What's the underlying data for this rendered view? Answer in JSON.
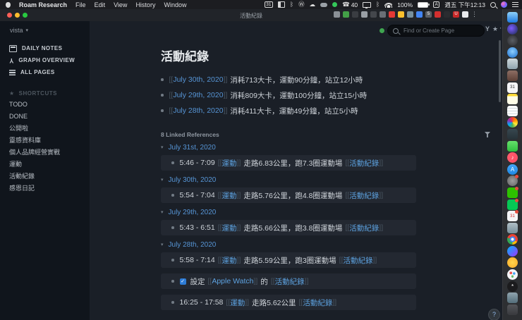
{
  "syntax": {
    "open": "[[",
    "close": "]]"
  },
  "menu_bar": {
    "app_name": "Roam Research",
    "menus": [
      "File",
      "Edit",
      "View",
      "History",
      "Window"
    ],
    "status_icons": [
      {
        "n": "calendar-date-icon",
        "t": "box",
        "v": "31"
      },
      {
        "n": "window-layout-icon",
        "t": "tiles"
      },
      {
        "n": "bluetooth-icon",
        "t": "glyph",
        "v": "ᛒ"
      },
      {
        "n": "wordpress-icon",
        "t": "glyph",
        "v": "Ⓦ"
      },
      {
        "n": "cloud-icon",
        "t": "glyph",
        "v": "☁"
      },
      {
        "n": "widget-pill-icon",
        "t": "pill"
      },
      {
        "n": "green-status-icon",
        "t": "dot"
      },
      {
        "n": "phone-calls-icon",
        "t": "phone",
        "v": "40"
      },
      {
        "n": "screen-mirroring-icon",
        "t": "display"
      },
      {
        "n": "bluetooth-icon-2",
        "t": "glyph",
        "v": "ᛒ"
      },
      {
        "n": "wifi-icon",
        "t": "wifi"
      },
      {
        "n": "battery-percentage",
        "t": "text",
        "v": "100%"
      },
      {
        "n": "battery-icon",
        "t": "battery"
      },
      {
        "n": "input-source-icon",
        "t": "box",
        "v": "A"
      },
      {
        "n": "menubar-clock",
        "t": "text",
        "v": "週五 下午12:13"
      },
      {
        "n": "spotlight-icon",
        "t": "search"
      },
      {
        "n": "siri-icon",
        "t": "siri"
      },
      {
        "n": "control-center-icon",
        "t": "lines"
      }
    ]
  },
  "window": {
    "title": "活動紀錄"
  },
  "extensions": [
    {
      "n": "shield-extension-icon",
      "bg": "#8a9096"
    },
    {
      "n": "leaf-extension-icon",
      "bg": "#43a047"
    },
    {
      "n": "dark-extension-icon",
      "bg": "#3a3d42"
    },
    {
      "n": "video-extension-icon",
      "bg": "#9aa0a6"
    },
    {
      "n": "pencil-extension-icon",
      "bg": "#44474c"
    },
    {
      "n": "gray-box-extension-icon",
      "bg": "#6a6f75"
    },
    {
      "n": "youtube-extension-icon",
      "bg": "#e53935"
    },
    {
      "n": "yellow-extension-icon",
      "bg": "#fbc02d"
    },
    {
      "n": "globe-extension-icon",
      "bg": "#78909c"
    },
    {
      "n": "blue-shield-extension-icon",
      "bg": "#4285f4"
    },
    {
      "n": "counter-extension-icon",
      "bg": "#5c6065",
      "g": "5"
    },
    {
      "n": "red-lines-extension-icon",
      "bg": "#d32f2f"
    },
    {
      "n": "dark-circle-extension-icon",
      "bg": "#2a2c30"
    },
    {
      "n": "u-extension-icon",
      "bg": "#c62828",
      "g": "U"
    },
    {
      "n": "light-extension-icon",
      "bg": "#e8eaed"
    }
  ],
  "extensions_more": "⋮",
  "topbar": {
    "graph_name": "vista",
    "search_placeholder": "Find or Create Page"
  },
  "sidebar": {
    "nav": [
      {
        "icon": "calendar-icon",
        "label": "DAILY NOTES"
      },
      {
        "icon": "graph-icon",
        "label": "GRAPH OVERVIEW"
      },
      {
        "icon": "pages-icon",
        "label": "ALL PAGES"
      }
    ],
    "shortcuts_header": "SHORTCUTS",
    "shortcuts": [
      "TODO",
      "DONE",
      "公開啦",
      "靈感資料庫",
      "個人品牌經營實戰",
      "運動",
      "活動紀錄",
      "感恩日記"
    ]
  },
  "page": {
    "title": "活動紀錄",
    "bullets": [
      {
        "link": "July 30th, 2020",
        "text": "消耗713大卡，運動90分鐘，站立12小時"
      },
      {
        "link": "July 29th, 2020",
        "text": "消耗809大卡，運動100分鐘，站立15小時"
      },
      {
        "link": "July 28th, 2020",
        "text": "消耗411大卡，運動49分鐘，站立5小時"
      }
    ]
  },
  "refs": {
    "header": "8 Linked References",
    "groups": [
      {
        "date": "July 31st, 2020",
        "rows": [
          {
            "pre": "5:46 - 7:09",
            "tag1": "運動",
            "mid": "走路6.83公里，跑7.3圈運動場",
            "tag2": "活動紀錄"
          }
        ]
      },
      {
        "date": "July 30th, 2020",
        "rows": [
          {
            "pre": "5:54 - 7:04",
            "tag1": "運動",
            "mid": "走路5.76公里，跑4.8圈運動場",
            "tag2": "活動紀錄"
          }
        ]
      },
      {
        "date": "July 29th, 2020",
        "rows": [
          {
            "pre": "5:43 - 6:51",
            "tag1": "運動",
            "mid": "走路5.66公里，跑3.8圈運動場",
            "tag2": "活動紀錄"
          }
        ]
      },
      {
        "date": "July 28th, 2020",
        "rows": [
          {
            "pre": "5:58 - 7:14",
            "tag1": "運動",
            "mid": "走路5.59公里，跑3圈運動場",
            "tag2": "活動紀錄"
          },
          {
            "checkbox": true,
            "check": "✓",
            "pre": "設定",
            "tag1": "Apple Watch",
            "mid": "的",
            "tag2": "活動紀錄"
          },
          {
            "pre": "16:25 - 17:58",
            "tag1": "運動",
            "mid": "走路5.62公里",
            "tag2": "活動紀錄"
          }
        ]
      }
    ]
  },
  "help": {
    "label": "?"
  },
  "dock": {
    "icons": [
      {
        "n": "finder-icon",
        "s": "r",
        "bg": "linear-gradient(180deg,#8ed0f8,#1e7ae0)"
      },
      {
        "n": "siri-dock-icon",
        "s": "c",
        "bg": "radial-gradient(circle at 40% 40%,#7b5cff,#1a2a4a)"
      },
      {
        "n": "launchpad-icon",
        "s": "c",
        "bg": "radial-gradient(circle,#5a5e64,#2a2a2e)"
      },
      {
        "n": "safari-icon",
        "s": "c",
        "bg": "radial-gradient(circle at 50% 40%,#8fd0ff,#1669c9)"
      },
      {
        "n": "preview-icon",
        "s": "r",
        "bg": "linear-gradient(#cfd8dc,#90a4ae)"
      },
      {
        "n": "contacts-icon",
        "s": "r",
        "bg": "linear-gradient(#8d6e63,#5d4037)"
      },
      {
        "n": "calendar-app-icon",
        "s": "r",
        "bg": "#f5f5f7",
        "g": "31",
        "gc": "#333"
      },
      {
        "n": "notes-icon",
        "s": "r",
        "bg": "linear-gradient(180deg,#fdd835 22%,#fffde7 22%)"
      },
      {
        "n": "textedit-icon",
        "s": "r",
        "bg": "repeating-linear-gradient(180deg,#fff 0 3px,#cfd8dc 3px 4px)"
      },
      {
        "n": "photos-icon",
        "s": "c",
        "bg": "conic-gradient(#f44336,#ff9800,#ffeb3b,#4caf50,#03a9f4,#9c27b0,#f44336)"
      },
      {
        "n": "facetime-icon",
        "s": "r",
        "bg": "linear-gradient(#37474f,#263238)"
      },
      {
        "n": "messages-icon",
        "s": "r",
        "bg": "linear-gradient(#66e06b,#2fbf3f)"
      },
      {
        "n": "music-icon",
        "s": "c",
        "bg": "linear-gradient(135deg,#ff5f6d,#fc4a64)",
        "g": "♪"
      },
      {
        "n": "app-store-icon",
        "s": "c",
        "bg": "linear-gradient(#42a5f5,#1e88e5)",
        "g": "A"
      },
      {
        "n": "system-preferences-icon",
        "s": "c",
        "bg": "radial-gradient(#9e9e9e,#616161)",
        "b": true
      },
      {
        "n": "wechat-icon",
        "s": "r",
        "bg": "#2dc100",
        "b": true
      },
      {
        "n": "line-icon",
        "s": "r",
        "bg": "#06c755",
        "b": true
      },
      {
        "n": "calendar-alt-icon",
        "s": "r",
        "bg": "#f5f5f7",
        "g": "31",
        "gc": "#d32f2f",
        "b": true
      },
      {
        "n": "screenshot-thumbnail-icon",
        "s": "r",
        "bg": "linear-gradient(#b0bec5,#78909c)"
      },
      {
        "n": "chrome-icon",
        "s": "c",
        "bg": "radial-gradient(circle,#fff 0 19%,#4285f4 20% 38%,transparent 39%),conic-gradient(#ea4335 0 33%,#fbbc05 33% 50%,#34a853 50% 80%,#ea4335 80%)"
      },
      {
        "n": "messenger-icon",
        "s": "c",
        "bg": "linear-gradient(135deg,#00b2ff,#a033ff)"
      },
      {
        "n": "butterfly-app-icon",
        "s": "c",
        "bg": "radial-gradient(#ffd54f,#f9a825)"
      },
      {
        "n": "color-dots-app-icon",
        "s": "c",
        "bg": "radial-gradient(circle at 35% 35%,#ef5350 0 13%,transparent 14%),radial-gradient(circle at 66% 40%,#42a5f5 0 13%,transparent 14%),radial-gradient(circle at 50% 68%,#66bb6a 0 13%,transparent 14%),#f5f5f7"
      },
      {
        "n": "asterisk-app-icon",
        "s": "c",
        "bg": "#1b1b1d",
        "g": "*",
        "gc": "#fff"
      },
      {
        "n": "downloads-thumbnail-icon",
        "s": "r",
        "bg": "linear-gradient(#90a4ae,#546e7a)"
      },
      {
        "n": "trash-icon",
        "s": "r",
        "bg": "linear-gradient(#55565a,#38393d)"
      }
    ]
  }
}
